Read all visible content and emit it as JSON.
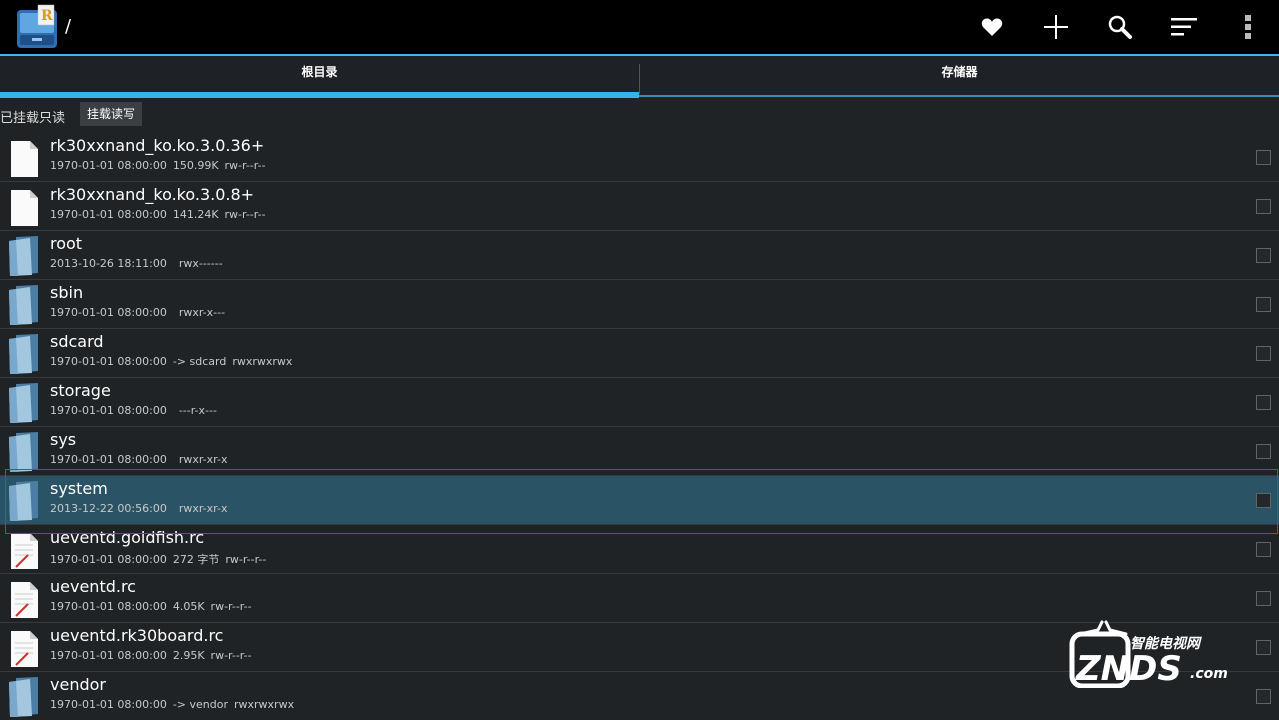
{
  "app": {
    "path": "/"
  },
  "actions": [
    {
      "name": "favorites-icon"
    },
    {
      "name": "add-icon"
    },
    {
      "name": "search-icon"
    },
    {
      "name": "sort-icon"
    },
    {
      "name": "overflow-menu-icon"
    }
  ],
  "tabs": [
    {
      "label": "根目录",
      "active": true
    },
    {
      "label": "存储器",
      "active": false
    }
  ],
  "mount": {
    "status": "已挂载只读",
    "button_label": "挂载读写"
  },
  "colors": {
    "accent": "#33b5e5",
    "selected_row": "#2a5465",
    "highlight_frame": "#d0283a"
  },
  "files": [
    {
      "name": "rk30xxnand_ko.ko.3.0.36+",
      "type": "file",
      "date": "1970-01-01 08:00:00",
      "size": "150.99K",
      "perms": "rw-r--r--",
      "selected": false
    },
    {
      "name": "rk30xxnand_ko.ko.3.0.8+",
      "type": "file",
      "date": "1970-01-01 08:00:00",
      "size": "141.24K",
      "perms": "rw-r--r--",
      "selected": false
    },
    {
      "name": "root",
      "type": "folder",
      "date": "2013-10-26 18:11:00",
      "size": "",
      "perms": "rwx------",
      "selected": false
    },
    {
      "name": "sbin",
      "type": "folder",
      "date": "1970-01-01 08:00:00",
      "size": "",
      "perms": "rwxr-x---",
      "selected": false
    },
    {
      "name": "sdcard",
      "type": "folder",
      "date": "1970-01-01 08:00:00",
      "size": "-> sdcard",
      "perms": "rwxrwxrwx",
      "selected": false
    },
    {
      "name": "storage",
      "type": "folder",
      "date": "1970-01-01 08:00:00",
      "size": "",
      "perms": "---r-x---",
      "selected": false
    },
    {
      "name": "sys",
      "type": "folder",
      "date": "1970-01-01 08:00:00",
      "size": "",
      "perms": "rwxr-xr-x",
      "selected": false
    },
    {
      "name": "system",
      "type": "folder",
      "date": "2013-12-22 00:56:00",
      "size": "",
      "perms": "rwxr-xr-x",
      "selected": true
    },
    {
      "name": "ueventd.goldfish.rc",
      "type": "script",
      "date": "1970-01-01 08:00:00",
      "size": "272 字节",
      "perms": "rw-r--r--",
      "selected": false
    },
    {
      "name": "ueventd.rc",
      "type": "script",
      "date": "1970-01-01 08:00:00",
      "size": "4.05K",
      "perms": "rw-r--r--",
      "selected": false
    },
    {
      "name": "ueventd.rk30board.rc",
      "type": "script",
      "date": "1970-01-01 08:00:00",
      "size": "2.95K",
      "perms": "rw-r--r--",
      "selected": false
    },
    {
      "name": "vendor",
      "type": "folder",
      "date": "1970-01-01 08:00:00",
      "size": "-> vendor",
      "perms": "rwxrwxrwx",
      "selected": false
    }
  ],
  "watermark": {
    "top_text": "智能电视网",
    "brand": "ZNDS",
    "suffix": ".com"
  }
}
